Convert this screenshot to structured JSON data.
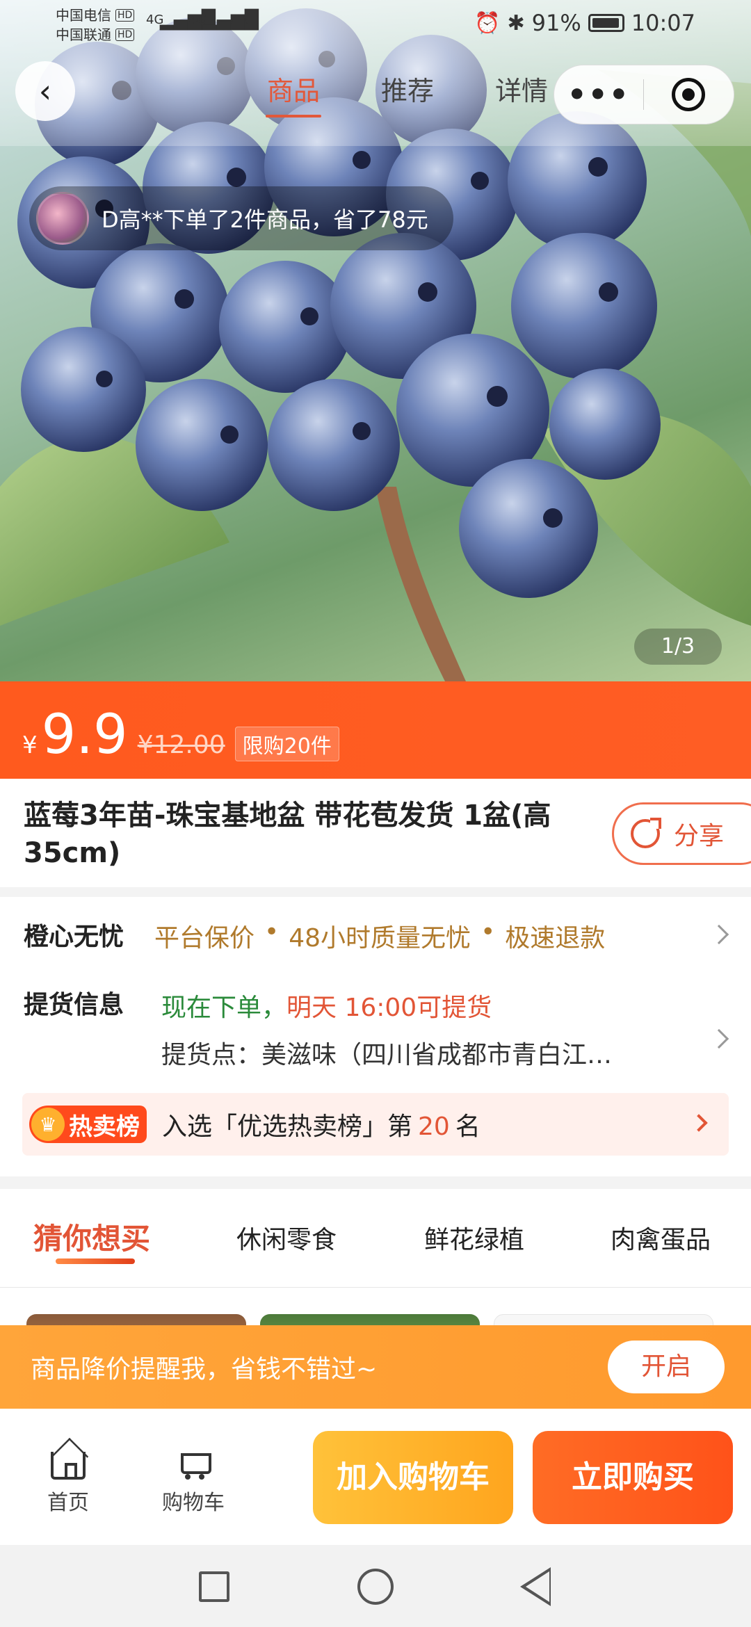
{
  "status_bar": {
    "carrier1": "中国电信",
    "carrier2": "中国联通",
    "hd": "HD",
    "net1": "4G",
    "net2": "4G",
    "battery": "91%",
    "time": "10:07"
  },
  "nav": {
    "tabs": [
      {
        "label": "商品",
        "active": true
      },
      {
        "label": "推荐",
        "active": false
      },
      {
        "label": "详情",
        "active": false
      }
    ],
    "more_label": "•••"
  },
  "order_toast": "D高**下单了2件商品，省了78元",
  "gallery": {
    "pager": "1/3"
  },
  "price": {
    "currency": "¥",
    "current": "9.9",
    "original": "¥12.00",
    "limit": "限购20件"
  },
  "product": {
    "title": "蓝莓3年苗-珠宝基地盆 带花苞发货 1盆(高35cm)",
    "share_label": "分享"
  },
  "guarantee": {
    "label": "橙心无忧",
    "items": [
      "平台保价",
      "48小时质量无忧",
      "极速退款"
    ],
    "separator": "•"
  },
  "pickup": {
    "label": "提货信息",
    "line1_prefix": "现在下单，",
    "line1_highlight": "明天 16:00可提货",
    "line2": "提货点：美滋味（四川省成都市青白江…"
  },
  "hot_rank": {
    "badge": "热卖榜",
    "text_prefix": "入选「优选热卖榜」第",
    "rank": "20",
    "text_suffix": "名"
  },
  "categories": [
    {
      "label": "猜你想买",
      "active": true
    },
    {
      "label": "休闲零食",
      "active": false
    },
    {
      "label": "鲜花绿植",
      "active": false
    },
    {
      "label": "肉禽蛋品",
      "active": false
    }
  ],
  "reminder": {
    "text": "商品降价提醒我，省钱不错过~",
    "button": "开启"
  },
  "actions": {
    "home": "首页",
    "cart": "购物车",
    "add_to_cart": "加入购物车",
    "buy_now": "立即购买"
  },
  "colors": {
    "brand_orange": "#ff5a1e",
    "accent_red": "#e25536",
    "gold": "#b07a2c",
    "green": "#2a8a3a"
  }
}
